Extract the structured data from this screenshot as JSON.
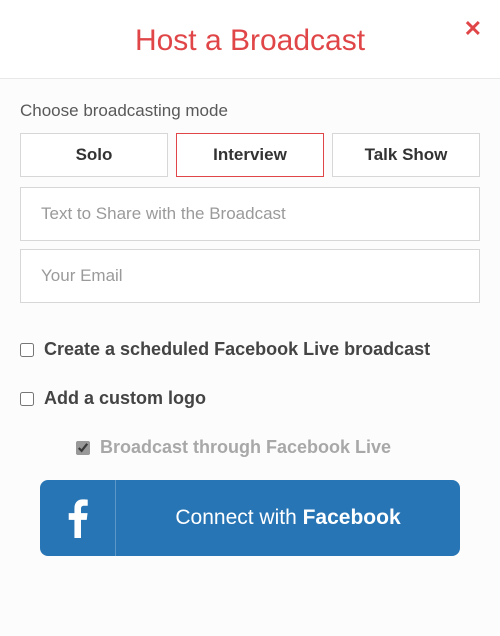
{
  "header": {
    "title": "Host a Broadcast"
  },
  "mode_section": {
    "label": "Choose broadcasting mode",
    "options": {
      "solo": "Solo",
      "interview": "Interview",
      "talk_show": "Talk Show"
    },
    "selected": "interview"
  },
  "inputs": {
    "share_text_placeholder": "Text to Share with the Broadcast",
    "share_text_value": "",
    "email_placeholder": "Your Email",
    "email_value": ""
  },
  "checks": {
    "scheduled": {
      "label": "Create a scheduled Facebook Live broadcast",
      "checked": false
    },
    "custom_logo": {
      "label": "Add a custom logo",
      "checked": false
    },
    "fb_live": {
      "label": "Broadcast through Facebook Live",
      "checked": true
    }
  },
  "connect": {
    "prefix": "Connect with ",
    "brand": "Facebook"
  },
  "colors": {
    "accent": "#e04648",
    "fb_blue": "#2775b5"
  }
}
